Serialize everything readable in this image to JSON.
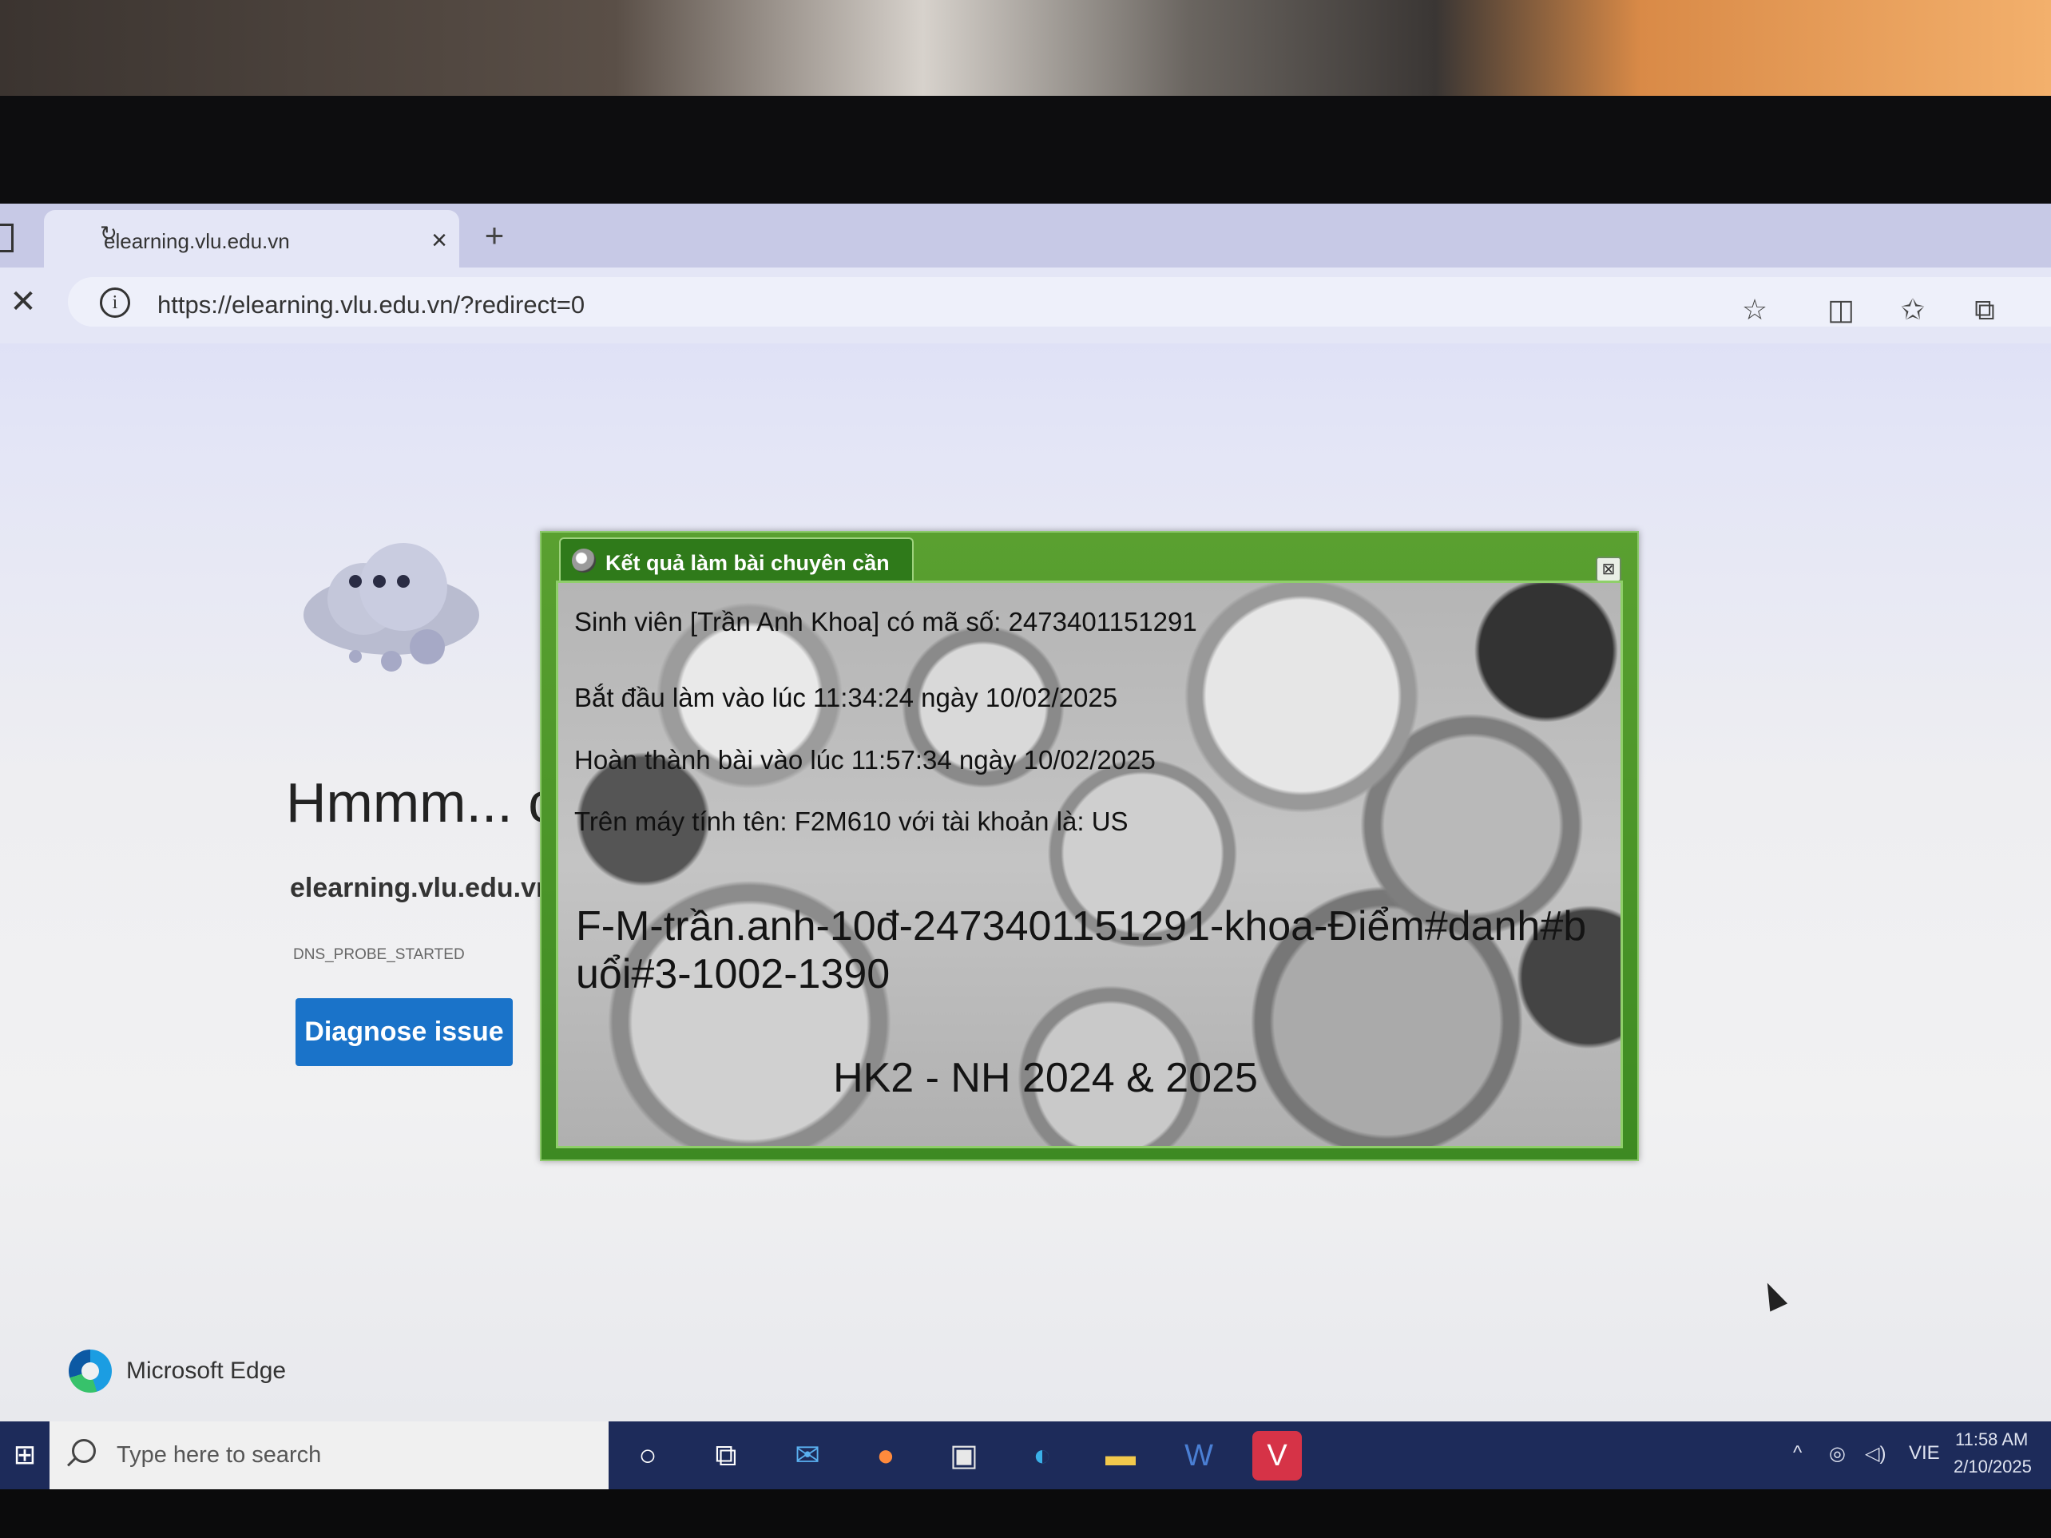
{
  "browser": {
    "tab_title": "elearning.vlu.edu.vn",
    "tab_close": "×",
    "new_tab": "+",
    "stop": "✕",
    "url": "https://elearning.vlu.edu.vn/?redirect=0"
  },
  "error_page": {
    "title": "Hmmm... c",
    "domain": "elearning.vlu.edu.vn",
    "error_code": "DNS_PROBE_STARTED",
    "diagnose_button": "Diagnose issue",
    "brand": "Microsoft Edge"
  },
  "dialog": {
    "title": "Kết quả làm bài chuyên cần",
    "close": "⊠",
    "student_line": "Sinh viên [Trần Anh Khoa] có mã số: 2473401151291",
    "start_line": "Bắt đầu làm vào lúc 11:34:24 ngày 10/02/2025",
    "finish_line": "Hoàn thành bài vào lúc 11:57:34 ngày 10/02/2025",
    "computer_line": "Trên máy tính tên: F2M610 với tài khoản là: US",
    "code_line": "F-M-trần.anh-10đ-2473401151291-khoa-Điểm#danh#buổi#3-1002-1390",
    "term_line": "HK2 - NH 2024 & 2025"
  },
  "taskbar": {
    "start": "⊞",
    "search_placeholder": "Type here to search",
    "apps": [
      "cortana-icon",
      "task-view-icon",
      "mail-icon",
      "firefox-icon",
      "store-icon",
      "edge-icon",
      "file-explorer-icon",
      "word-icon",
      "vivaldi-icon"
    ],
    "tray_language": "VIE",
    "time": "11:58 AM",
    "date": "2/10/2025"
  },
  "colors": {
    "dialog_green": "#3d8a22",
    "button_blue": "#1a73c9",
    "taskbar": "#1d2b5a"
  }
}
